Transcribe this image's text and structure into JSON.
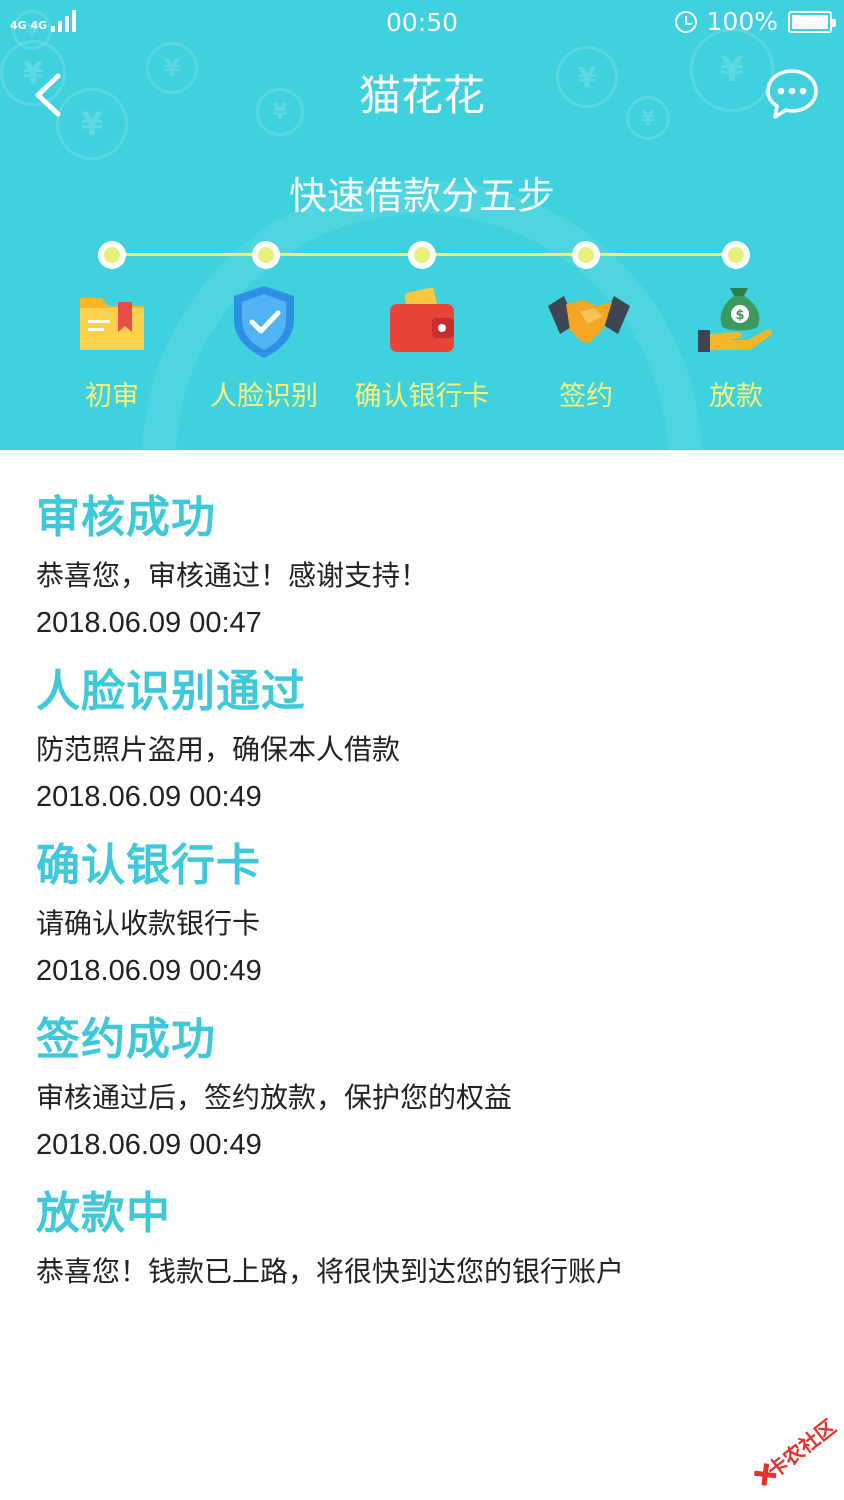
{
  "status_bar": {
    "signal": "4G 4G",
    "time": "00:50",
    "battery": "100%"
  },
  "nav": {
    "title": "猫花花",
    "back_icon": "back-arrow-icon",
    "chat_icon": "chat-bubble-icon"
  },
  "steps": {
    "title": "快速借款分五步",
    "items": [
      {
        "label": "初审",
        "icon": "folder-icon"
      },
      {
        "label": "人脸识别",
        "icon": "shield-check-icon"
      },
      {
        "label": "确认银行卡",
        "icon": "wallet-icon"
      },
      {
        "label": "签约",
        "icon": "handshake-icon"
      },
      {
        "label": "放款",
        "icon": "money-bag-icon"
      }
    ]
  },
  "timeline": [
    {
      "title": "审核成功",
      "desc": "恭喜您，审核通过！感谢支持！",
      "time": "2018.06.09  00:47"
    },
    {
      "title": "人脸识别通过",
      "desc": "防范照片盗用，确保本人借款",
      "time": "2018.06.09  00:49"
    },
    {
      "title": "确认银行卡",
      "desc": "请确认收款银行卡",
      "time": "2018.06.09  00:49"
    },
    {
      "title": "签约成功",
      "desc": "审核通过后，签约放款，保护您的权益",
      "time": "2018.06.09  00:49"
    },
    {
      "title": "放款中",
      "desc": "恭喜您！钱款已上路，将很快到达您的银行账户"
    }
  ],
  "watermark": "卡农社区",
  "colors": {
    "header_bg": "#3fd2de",
    "accent_title": "#3fc9d8",
    "step_label": "#f6f27c",
    "progress": "#e7f07a"
  }
}
